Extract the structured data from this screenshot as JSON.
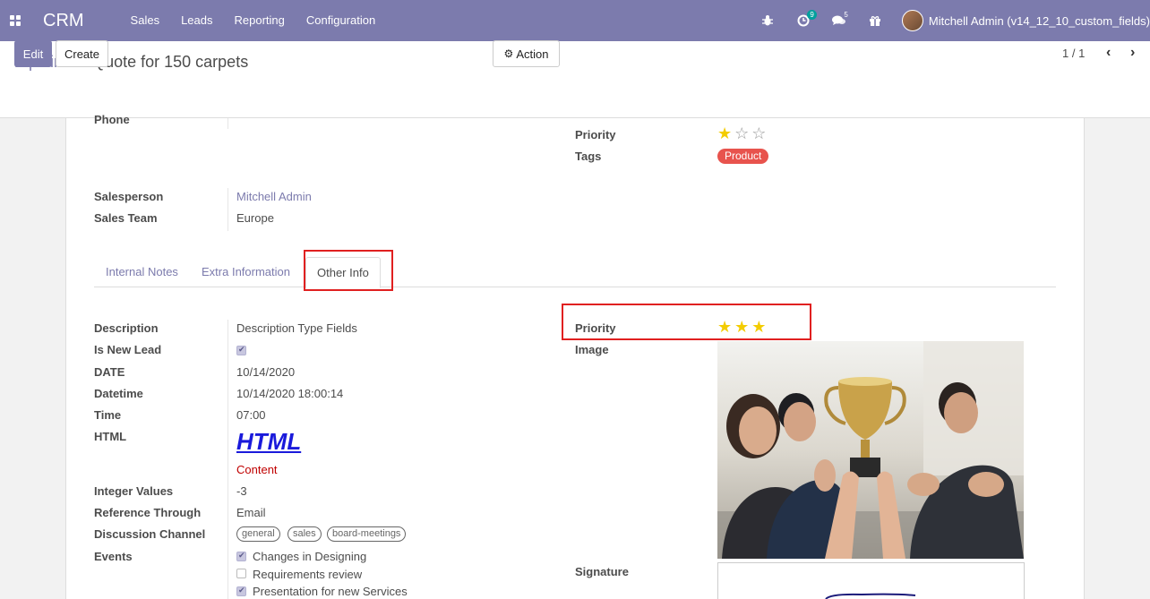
{
  "navbar": {
    "brand": "CRM",
    "menu": [
      "Sales",
      "Leads",
      "Reporting",
      "Configuration"
    ],
    "activity_count": "9",
    "message_count": "5",
    "user_name": "Mitchell Admin (v14_12_10_custom_fields)"
  },
  "breadcrumb": {
    "parent": "Pipeline",
    "separator": "/",
    "current": "Quote for 150 carpets"
  },
  "buttons": {
    "edit": "Edit",
    "create": "Create",
    "action": "Action"
  },
  "pager": {
    "value": "1 / 1"
  },
  "top_fields": {
    "phone_label": "Phone",
    "priority_label": "Priority",
    "priority_value": 1,
    "priority_max": 3,
    "tags_label": "Tags",
    "tag": "Product",
    "salesperson_label": "Salesperson",
    "salesperson_value": "Mitchell Admin",
    "sales_team_label": "Sales Team",
    "sales_team_value": "Europe"
  },
  "tabs": [
    "Internal Notes",
    "Extra Information",
    "Other Info"
  ],
  "active_tab": "Other Info",
  "other_info": {
    "description_label": "Description",
    "description_value": "Description Type Fields",
    "is_new_lead_label": "Is New Lead",
    "is_new_lead_value": true,
    "date_label": "DATE",
    "date_value": "10/14/2020",
    "datetime_label": "Datetime",
    "datetime_value": "10/14/2020 18:00:14",
    "time_label": "Time",
    "time_value": "07:00",
    "html_label": "HTML",
    "html_heading": "HTML",
    "html_content": "Content",
    "integer_label": "Integer Values",
    "integer_value": "-3",
    "reference_label": "Reference Through",
    "reference_value": "Email",
    "discussion_label": "Discussion Channel",
    "discussion_channels": [
      "general",
      "sales",
      "board-meetings"
    ],
    "events_label": "Events",
    "events": [
      {
        "label": "Changes in Designing",
        "checked": true
      },
      {
        "label": "Requirements review",
        "checked": false
      },
      {
        "label": "Presentation for new Services",
        "checked": true
      }
    ],
    "priority_label": "Priority",
    "priority_value": 3,
    "priority_max": 3,
    "image_label": "Image",
    "signature_label": "Signature"
  },
  "colors": {
    "brand": "#7c7bad",
    "tag_red": "#e8534d",
    "star": "#f3cc00",
    "highlight": "#e02020"
  }
}
